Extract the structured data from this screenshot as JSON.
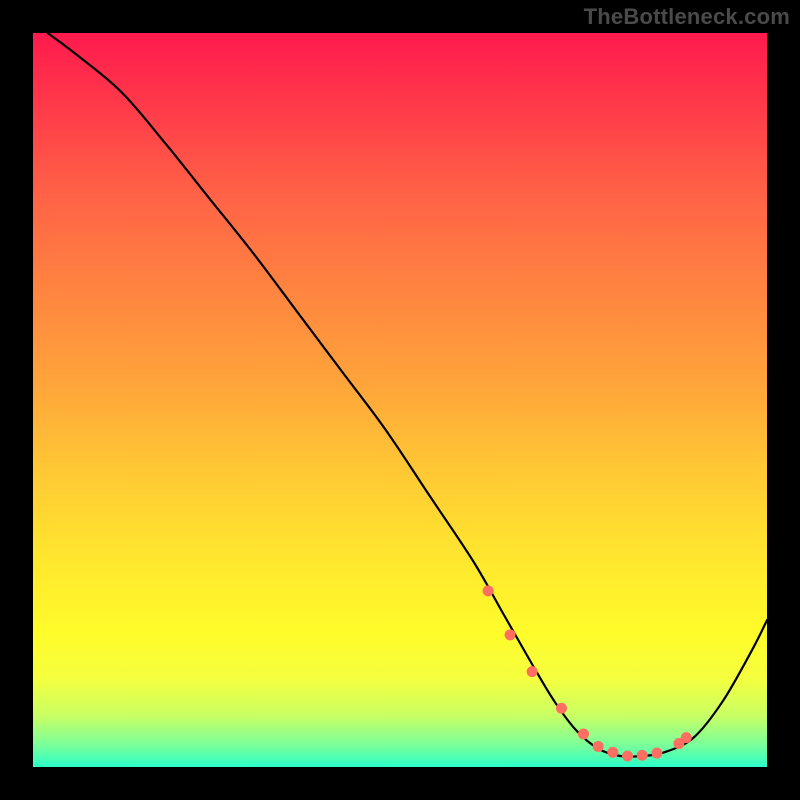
{
  "watermark": "TheBottleneck.com",
  "chart_data": {
    "type": "line",
    "title": "",
    "xlabel": "",
    "ylabel": "",
    "xlim": [
      0,
      100
    ],
    "ylim": [
      0,
      100
    ],
    "series": [
      {
        "name": "curve",
        "x": [
          2,
          6,
          12,
          18,
          24,
          30,
          36,
          42,
          48,
          54,
          60,
          64,
          68,
          71,
          74,
          77,
          80,
          83,
          86,
          90,
          94,
          98,
          100
        ],
        "values": [
          100,
          97,
          92,
          85,
          77.5,
          70,
          62,
          54,
          46,
          37,
          28,
          21,
          14,
          9,
          5,
          2.5,
          1.5,
          1.5,
          2,
          4,
          9,
          16,
          20
        ]
      }
    ],
    "markers": {
      "name": "highlight-points",
      "color": "#ff6f61",
      "x": [
        62,
        65,
        68,
        72,
        75,
        77,
        79,
        81,
        83,
        85,
        88,
        89
      ],
      "values": [
        24,
        18,
        13,
        8,
        4.5,
        2.8,
        2,
        1.5,
        1.6,
        1.9,
        3.2,
        4
      ]
    }
  }
}
